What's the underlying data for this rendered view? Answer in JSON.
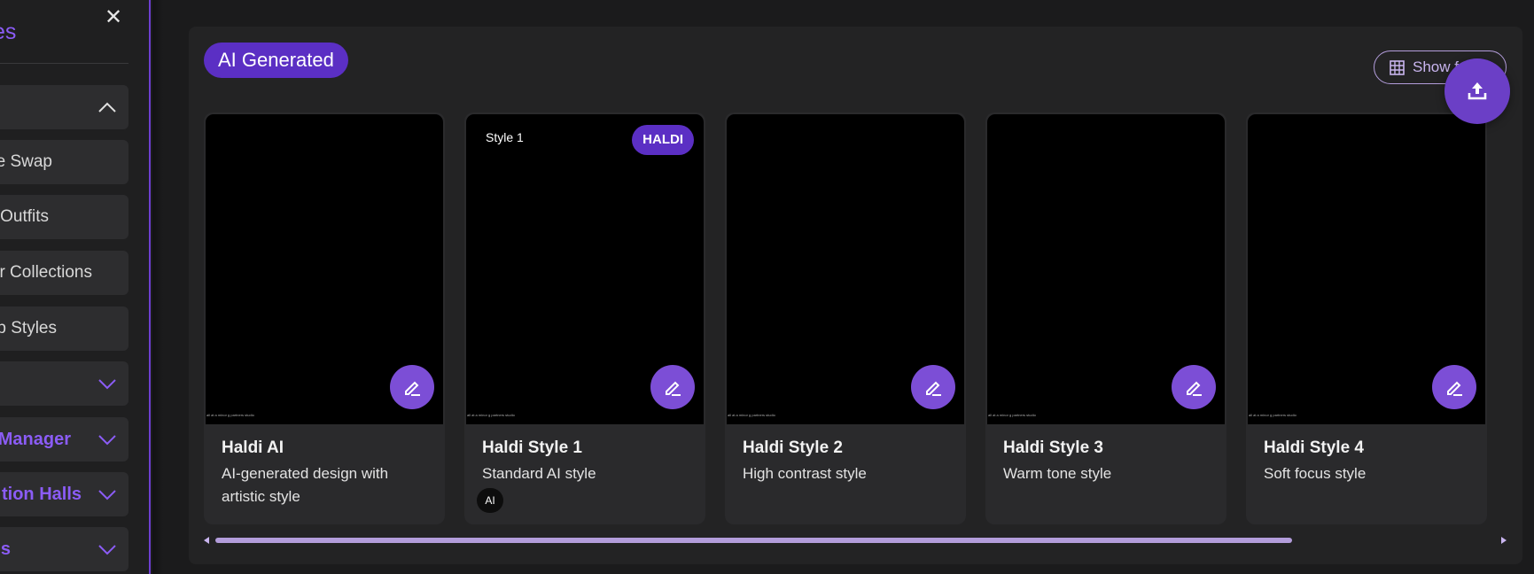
{
  "sidebar": {
    "close_glyph": "✕",
    "title": "es",
    "items": [
      {
        "label": ""
      },
      {
        "label": "Face Swap"
      },
      {
        "label": "Outfits"
      },
      {
        "label": "r Collections"
      },
      {
        "label": "p Styles"
      },
      {
        "label": ""
      },
      {
        "label": "Manager"
      },
      {
        "label": "tion Halls"
      },
      {
        "label": "s"
      }
    ]
  },
  "header": {
    "badge": "AI Generated",
    "show_button": "Show f"
  },
  "cards": [
    {
      "title": "Haldi AI",
      "desc": "AI-generated design with artistic style",
      "tiny": "all at a minor g partners studio"
    },
    {
      "title": "Haldi Style 1",
      "desc": "Standard AI style",
      "style_tag": "Style 1",
      "badge": "HALDI",
      "chip": "AI",
      "tiny": "all at a minor g partners studio"
    },
    {
      "title": "Haldi Style 2",
      "desc": "High contrast style",
      "tiny": "all at a minor g partners studio"
    },
    {
      "title": "Haldi Style 3",
      "desc": "Warm tone style",
      "tiny": "all at a minor g partners studio"
    },
    {
      "title": "Haldi Style 4",
      "desc": "Soft focus style",
      "tiny": "all at a minor g partners studio"
    }
  ],
  "colors": {
    "accent": "#6b3fc6",
    "badge": "#5b2fc4",
    "scroll_thumb": "#b39ddb"
  },
  "icons": [
    "close-icon",
    "chevron-up-icon",
    "chevron-down-icon",
    "grid-icon",
    "upload-icon",
    "edit-icon"
  ]
}
